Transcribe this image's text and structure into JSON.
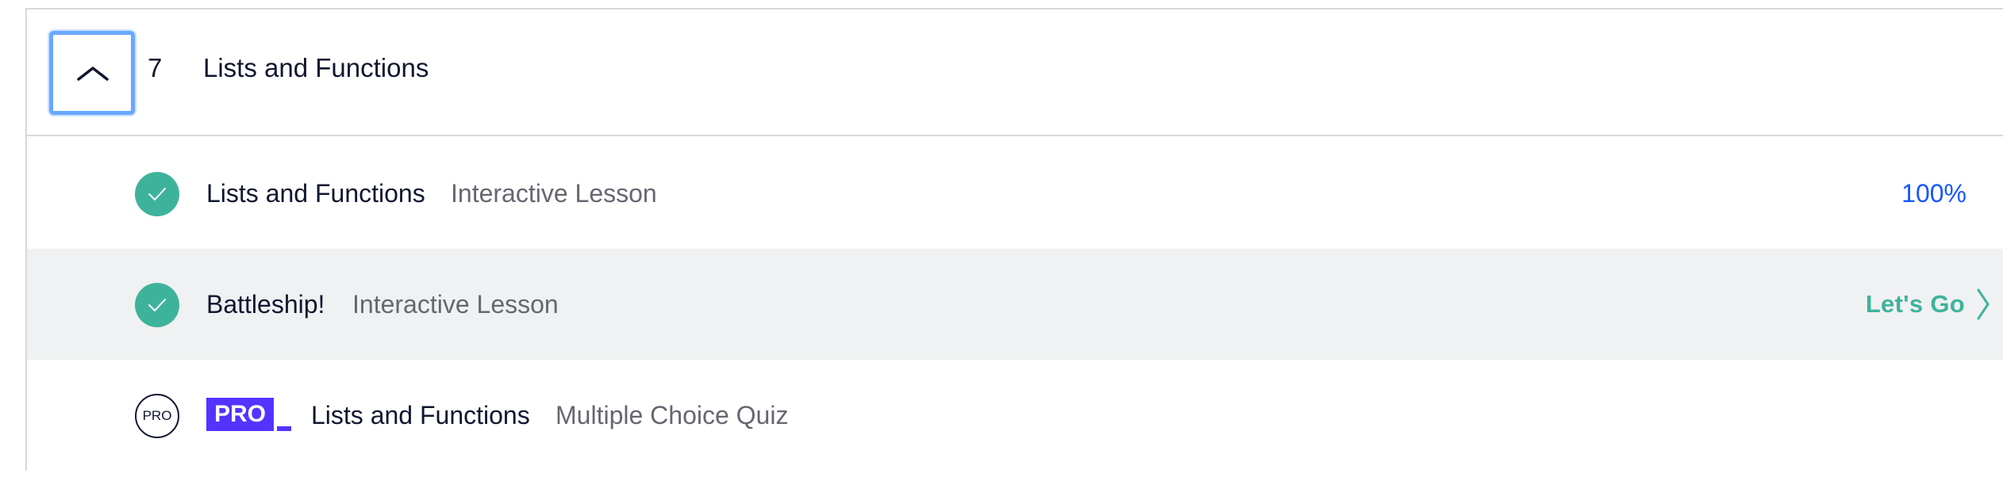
{
  "module": {
    "number": "7",
    "title": "Lists and Functions",
    "toggle_icon": "chevron-up-icon"
  },
  "lessons": [
    {
      "title": "Lists and Functions",
      "type": "Interactive Lesson",
      "status": "complete",
      "progress": "100%"
    },
    {
      "title": "Battleship!",
      "type": "Interactive Lesson",
      "status": "complete",
      "action_label": "Let's Go"
    },
    {
      "title": "Lists and Functions",
      "type": "Multiple Choice Quiz",
      "status": "locked",
      "status_label": "PRO",
      "badge_label": "PRO"
    }
  ],
  "colors": {
    "complete_green": "#3eb39b",
    "progress_blue": "#1557ff",
    "pro_purple": "#5533ff",
    "focus_ring": "#6aa8ff",
    "row_highlight": "#f0f1f2"
  }
}
